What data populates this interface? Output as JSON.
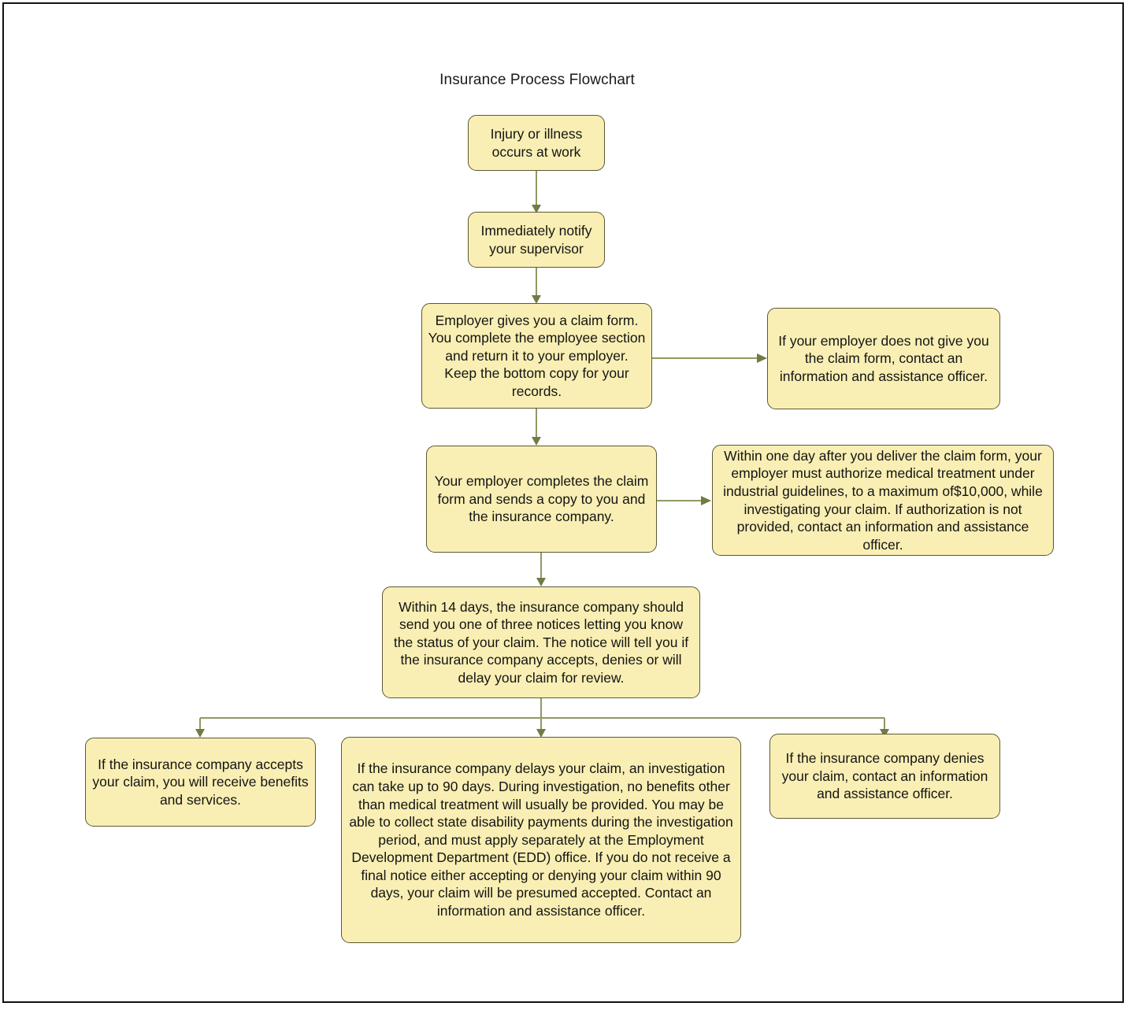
{
  "chart_data": {
    "type": "diagram",
    "title": "Insurance Process Flowchart",
    "diagram_kind": "flowchart",
    "orientation": "top-to-bottom",
    "node_fill": "#f9efb4",
    "node_border": "#5c5833",
    "connector_color": "#8e9a63",
    "frame_border": "#111111",
    "nodes": [
      {
        "id": "n1",
        "label": "Injury or illness occurs at work"
      },
      {
        "id": "n2",
        "label": "Immediately notify your supervisor"
      },
      {
        "id": "n3",
        "label": "Employer gives you a claim form. You complete the employee section and return it to your employer. Keep the bottom copy for your records."
      },
      {
        "id": "n3b",
        "label": "If your employer does not give you the claim form, contact an information and assistance officer."
      },
      {
        "id": "n4",
        "label": "Your employer completes the claim form and sends a copy to you and the insurance company."
      },
      {
        "id": "n4b",
        "label": "Within one day after you deliver the claim form, your employer must authorize medical treatment under industrial guidelines, to a maximum of$10,000, while investigating your claim. If authorization is not provided, contact an information and assistance officer."
      },
      {
        "id": "n5",
        "label": "Within 14 days, the insurance company should send you one of three notices letting you know the status of your claim. The notice will tell you if the insurance company accepts, denies or will delay your claim for review."
      },
      {
        "id": "n6a",
        "label": "If the insurance company accepts your claim, you will receive benefits and services."
      },
      {
        "id": "n6b",
        "label": "If the insurance company delays your claim, an investigation can take up to 90 days. During investigation, no benefits other than medical treatment will usually be provided. You may be able to collect state disability payments during the investigation period, and must apply separately at the Employment Development Department (EDD) office. If you do not receive a final notice either accepting or denying your claim within 90 days, your claim will be presumed accepted. Contact an information and assistance officer."
      },
      {
        "id": "n6c",
        "label": "If the insurance company denies your claim, contact an information and assistance officer."
      }
    ],
    "edges": [
      {
        "from": "n1",
        "to": "n2",
        "direction": "down"
      },
      {
        "from": "n2",
        "to": "n3",
        "direction": "down"
      },
      {
        "from": "n3",
        "to": "n3b",
        "direction": "right"
      },
      {
        "from": "n3",
        "to": "n4",
        "direction": "down"
      },
      {
        "from": "n4",
        "to": "n4b",
        "direction": "right"
      },
      {
        "from": "n4",
        "to": "n5",
        "direction": "down"
      },
      {
        "from": "n5",
        "to": "n6a",
        "direction": "down-left"
      },
      {
        "from": "n5",
        "to": "n6b",
        "direction": "down"
      },
      {
        "from": "n5",
        "to": "n6c",
        "direction": "down-right"
      }
    ]
  }
}
